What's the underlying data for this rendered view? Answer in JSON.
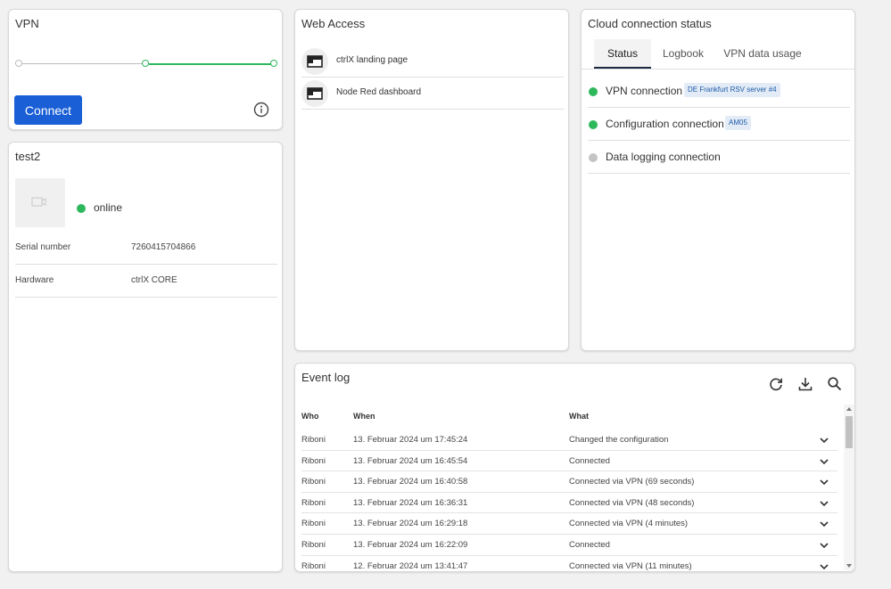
{
  "vpn": {
    "title": "VPN",
    "connect_label": "Connect"
  },
  "device": {
    "name": "test2",
    "status": "online",
    "rows": [
      {
        "label": "Serial number",
        "value": "7260415704866"
      },
      {
        "label": "Hardware",
        "value": "ctrlX CORE"
      }
    ]
  },
  "web_access": {
    "title": "Web Access",
    "items": [
      {
        "label": "ctrlX landing page"
      },
      {
        "label": "Node Red dashboard"
      }
    ]
  },
  "cloud": {
    "title": "Cloud connection status",
    "tabs": [
      {
        "label": "Status"
      },
      {
        "label": "Logbook"
      },
      {
        "label": "VPN data usage"
      }
    ],
    "connections": [
      {
        "label": "VPN connection",
        "badge": "DE Frankfurt RSV server #4",
        "color": "#2eb85c"
      },
      {
        "label": "Configuration connection",
        "badge": "AM05",
        "color": "#2eb85c"
      },
      {
        "label": "Data logging connection",
        "badge": "",
        "color": "#c4c4c4"
      }
    ]
  },
  "event_log": {
    "title": "Event log",
    "columns": {
      "who": "Who",
      "when": "When",
      "what": "What"
    },
    "rows": [
      {
        "who": "Riboni",
        "when": "13. Februar 2024 um 17:45:24",
        "what": "Changed the configuration"
      },
      {
        "who": "Riboni",
        "when": "13. Februar 2024 um 16:45:54",
        "what": "Connected"
      },
      {
        "who": "Riboni",
        "when": "13. Februar 2024 um 16:40:58",
        "what": "Connected via VPN (69 seconds)"
      },
      {
        "who": "Riboni",
        "when": "13. Februar 2024 um 16:36:31",
        "what": "Connected via VPN (48 seconds)"
      },
      {
        "who": "Riboni",
        "when": "13. Februar 2024 um 16:29:18",
        "what": "Connected via VPN (4 minutes)"
      },
      {
        "who": "Riboni",
        "when": "13. Februar 2024 um 16:22:09",
        "what": "Connected"
      },
      {
        "who": "Riboni",
        "when": "12. Februar 2024 um 13:41:47",
        "what": "Connected via VPN (11 minutes)"
      }
    ]
  },
  "colors": {
    "accent": "#1a5fd6",
    "online": "#2eb85c",
    "offline": "#c4c4c4",
    "tab_indicator": "#1d2a44"
  }
}
